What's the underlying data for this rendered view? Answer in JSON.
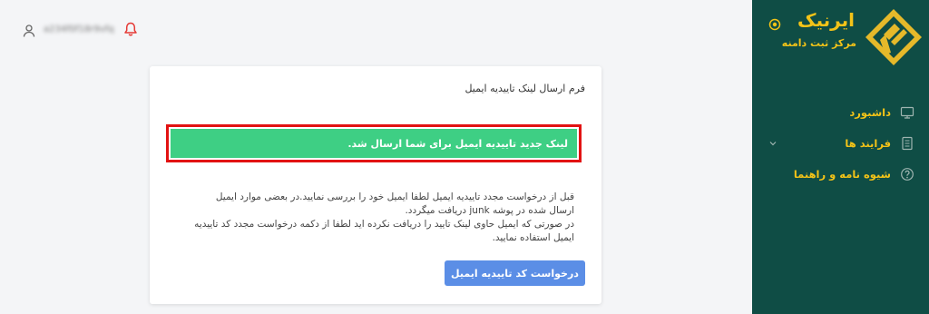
{
  "header": {
    "username": "a234f0f18r9vfq",
    "user_icon": "user-icon",
    "bell_icon": "bell-icon"
  },
  "sidebar": {
    "brand_title": "ایرنیک",
    "brand_subtitle": "مرکز ثبت دامنه",
    "background": "#0f4d45",
    "accent": "#f3c318",
    "items": [
      {
        "label": "داشبورد",
        "icon": "monitor-icon"
      },
      {
        "label": "فرایند ها",
        "icon": "document-icon",
        "has_submenu": true
      },
      {
        "label": "شیوه نامه و راهنما",
        "icon": "help-icon"
      }
    ]
  },
  "card": {
    "title": "فرم ارسال لینک تاییدیه ایمیل",
    "alert_text": "لینک جدید تاییدیه ایمیل برای شما ارسال شد.",
    "alert_color": "#3ecf84",
    "info_line1": "قبل از درخواست مجدد تاییدیه ایمیل لطفا ایمیل خود را بررسی نمایید.در بعضی موارد ایمیل ارسال شده در پوشه junk دریافت میگردد.",
    "info_line2": "در صورتی که ایمیل حاوی لینک تایید را دریافت نکرده اید لطفا از دکمه درخواست مجدد کد تاییدیه ایمیل استفاده نمایید.",
    "button_label": "درخواست کد تاییدیه ایمیل",
    "button_color": "#5b8ee6"
  }
}
